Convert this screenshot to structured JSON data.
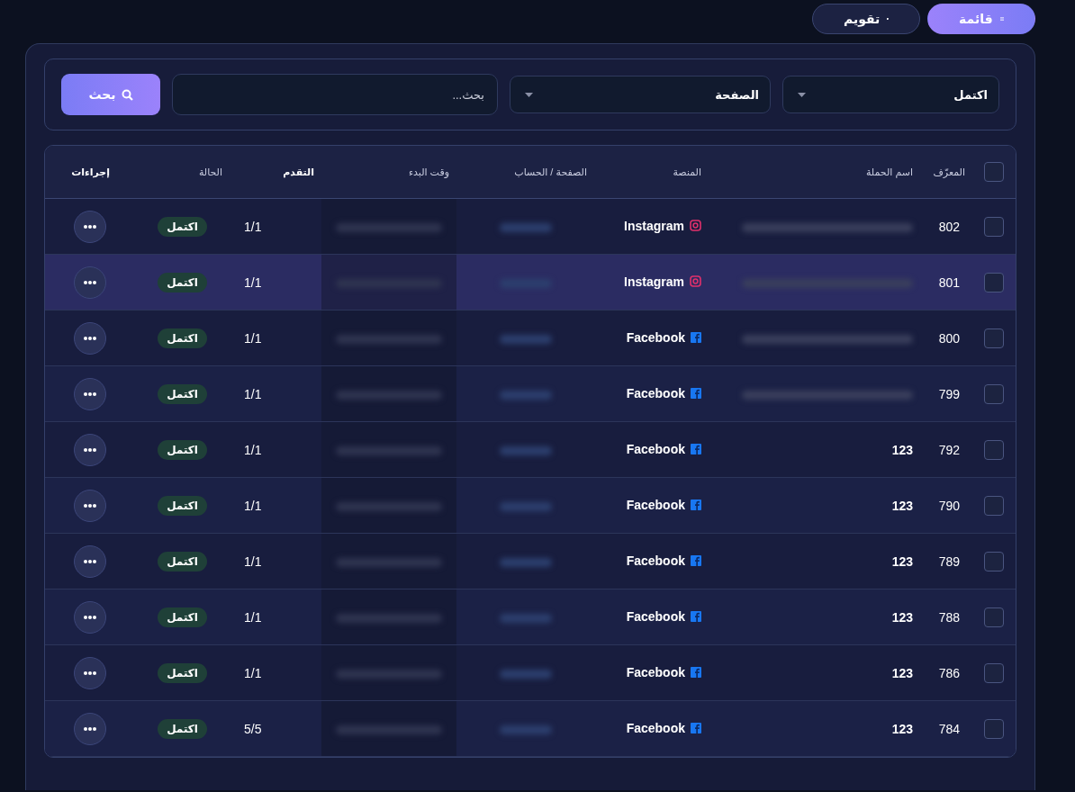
{
  "view_switch": [
    {
      "label": "قائمة",
      "selected": true
    },
    {
      "label": "تقويم",
      "selected": false
    }
  ],
  "filters": {
    "status": {
      "value": "اكتمل"
    },
    "page": {
      "value": "الصفحة"
    },
    "search": {
      "placeholder": "بحث..."
    },
    "search_button": "بحث"
  },
  "table": {
    "all_checked": false,
    "columns": [
      "المعرّف",
      "اسم الحملة",
      "المنصة",
      "الصفحة / الحساب",
      "وقت البدء",
      "التقدم",
      "الحالة",
      "إجراءات"
    ],
    "rows": [
      {
        "id": "802",
        "platform": "Instagram",
        "kind": "instagram",
        "progress": "1/1",
        "status": "اكتمل",
        "checked": false,
        "highlighted": false
      },
      {
        "id": "801",
        "platform": "Instagram",
        "kind": "instagram",
        "progress": "1/1",
        "status": "اكتمل",
        "checked": false,
        "highlighted": true
      },
      {
        "id": "800",
        "platform": "Facebook",
        "kind": "facebook",
        "progress": "1/1",
        "status": "اكتمل",
        "checked": false,
        "highlighted": false
      },
      {
        "id": "799",
        "platform": "Facebook",
        "kind": "facebook",
        "progress": "1/1",
        "status": "اكتمل",
        "checked": false,
        "highlighted": false
      },
      {
        "id": "792",
        "name": "123",
        "platform": "Facebook",
        "kind": "facebook",
        "progress": "1/1",
        "status": "اكتمل",
        "checked": false,
        "highlighted": false
      },
      {
        "id": "790",
        "name": "123",
        "platform": "Facebook",
        "kind": "facebook",
        "progress": "1/1",
        "status": "اكتمل",
        "checked": false,
        "highlighted": false
      },
      {
        "id": "789",
        "name": "123",
        "platform": "Facebook",
        "kind": "facebook",
        "progress": "1/1",
        "status": "اكتمل",
        "checked": false,
        "highlighted": false
      },
      {
        "id": "788",
        "name": "123",
        "platform": "Facebook",
        "kind": "facebook",
        "progress": "1/1",
        "status": "اكتمل",
        "checked": false,
        "highlighted": false
      },
      {
        "id": "786",
        "name": "123",
        "platform": "Facebook",
        "kind": "facebook",
        "progress": "1/1",
        "status": "اكتمل",
        "checked": false,
        "highlighted": false
      },
      {
        "id": "784",
        "name": "123",
        "platform": "Facebook",
        "kind": "facebook",
        "progress": "5/5",
        "status": "اكتمل",
        "checked": false,
        "highlighted": false
      }
    ]
  }
}
